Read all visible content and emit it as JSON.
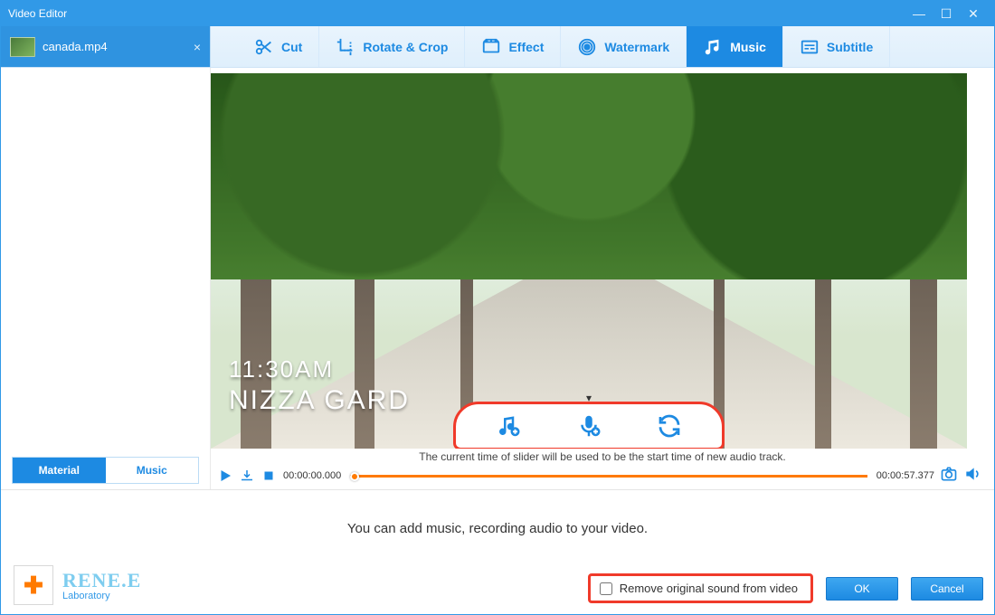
{
  "window": {
    "title": "Video Editor"
  },
  "file_tab": {
    "name": "canada.mp4"
  },
  "tool_tabs": [
    {
      "id": "cut",
      "label": "Cut"
    },
    {
      "id": "rotate",
      "label": "Rotate & Crop"
    },
    {
      "id": "effect",
      "label": "Effect"
    },
    {
      "id": "watermark",
      "label": "Watermark"
    },
    {
      "id": "music",
      "label": "Music",
      "active": true
    },
    {
      "id": "subtitle",
      "label": "Subtitle"
    }
  ],
  "sidebar_tabs": {
    "material": "Material",
    "music": "Music",
    "active": "material"
  },
  "preview_overlay": {
    "line1": "11:30AM",
    "line2": "NIZZA GARD"
  },
  "hint": "The current time of slider will be used to be the start time of new audio track.",
  "timecodes": {
    "start": "00:00:00.000",
    "end": "00:00:57.377"
  },
  "lower": {
    "message": "You can add music, recording audio to your video.",
    "checkbox_label": "Remove original sound from video",
    "ok": "OK",
    "cancel": "Cancel"
  },
  "logo": {
    "name": "RENE.E",
    "sub": "Laboratory"
  }
}
